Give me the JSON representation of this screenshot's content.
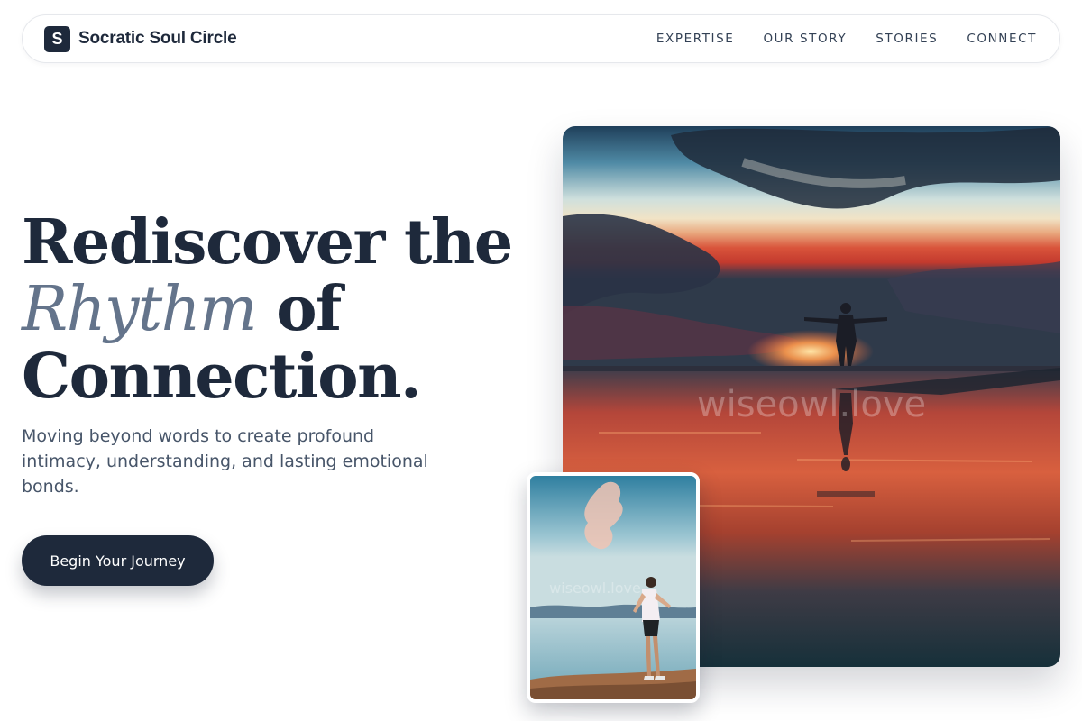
{
  "nav": {
    "brand_initial": "S",
    "brand_name": "Socratic Soul Circle",
    "links": [
      "EXPERTISE",
      "OUR STORY",
      "STORIES",
      "CONNECT"
    ]
  },
  "hero": {
    "headline_line1": "Rediscover the",
    "headline_accent": "Rhythm",
    "headline_line2_rest": " of",
    "headline_line3": "Connection.",
    "subtitle": "Moving beyond words to create profound intimacy, understanding, and lasting emotional bonds.",
    "cta_label": "Begin Your Journey"
  },
  "images": {
    "main_watermark": "wiseowl.love",
    "inset_watermark": "wiseowl.love"
  },
  "colors": {
    "primary": "#1e293b",
    "accent": "#64748b",
    "text_muted": "#475569"
  }
}
